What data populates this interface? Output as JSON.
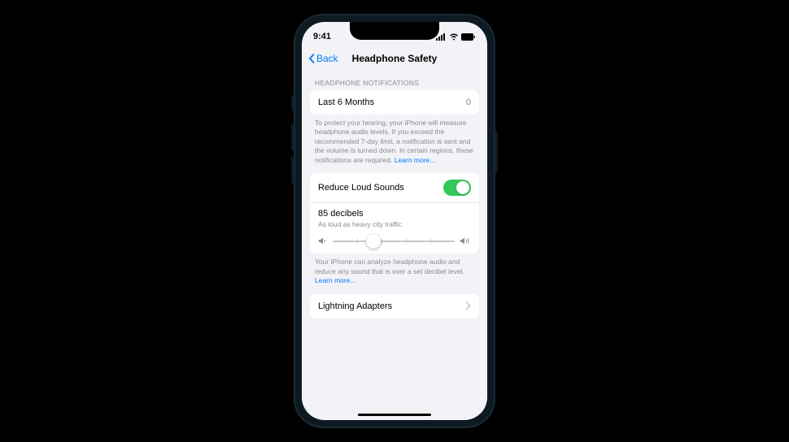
{
  "status": {
    "time": "9:41"
  },
  "nav": {
    "back": "Back",
    "title": "Headphone Safety"
  },
  "notifications": {
    "header": "HEADPHONE NOTIFICATIONS",
    "row_label": "Last 6 Months",
    "row_value": "0",
    "footer": "To protect your hearing, your iPhone will measure headphone audio levels. If you exceed the recommended 7-day limit, a notification is sent and the volume is turned down. In certain regions, these notifications are required. ",
    "learn_more": "Learn more..."
  },
  "reduce": {
    "toggle_label": "Reduce Loud Sounds",
    "toggle_on": true,
    "level_label": "85 decibels",
    "level_sub": "As loud as heavy city traffic",
    "slider_percent": 33,
    "footer": "Your iPhone can analyze headphone audio and reduce any sound that is over a set decibel level. ",
    "learn_more": "Learn more..."
  },
  "adapters": {
    "label": "Lightning Adapters"
  }
}
